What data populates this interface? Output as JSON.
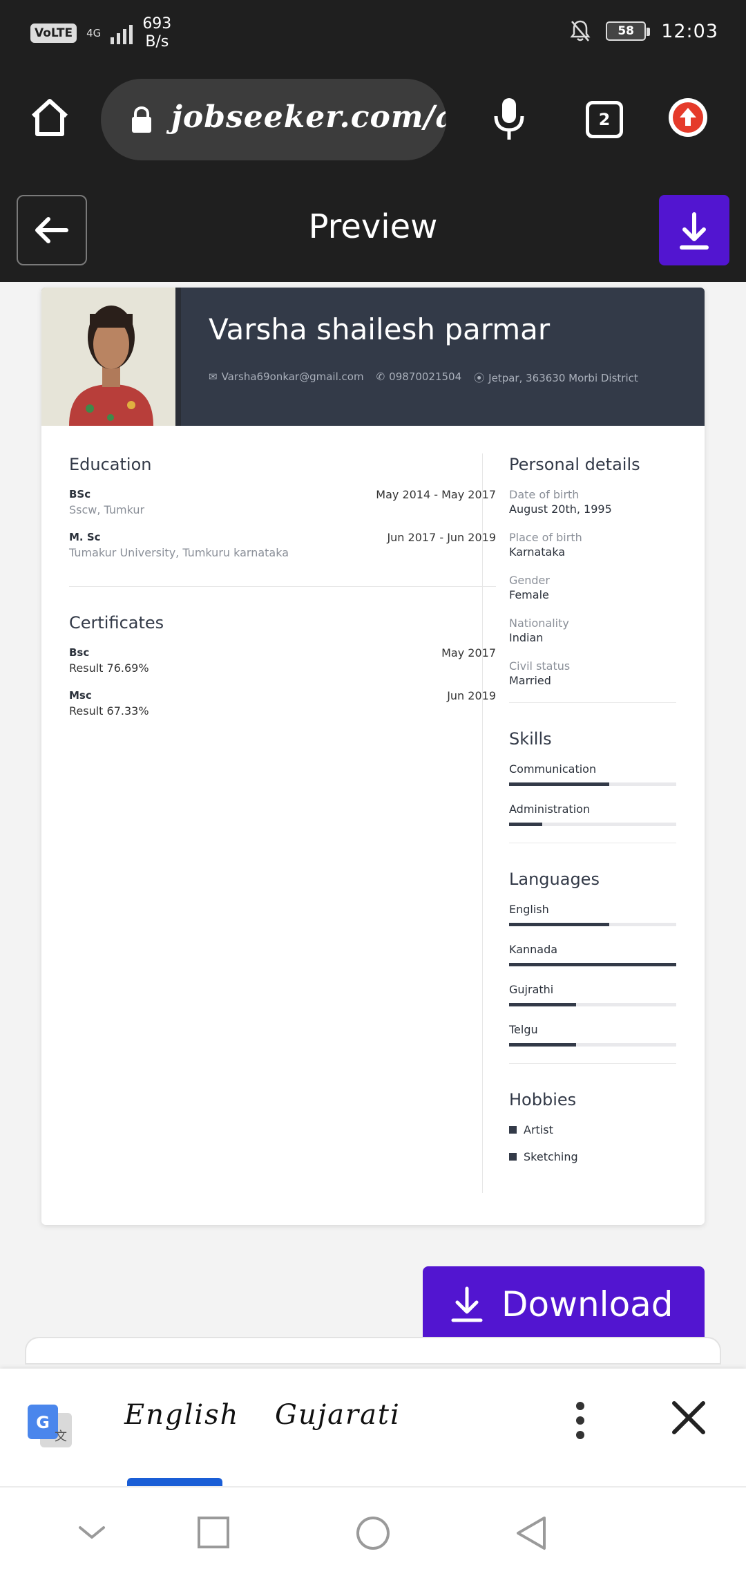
{
  "status_bar": {
    "network_badge": "VoLTE",
    "network_type": "4G",
    "speed_value": "693",
    "speed_unit": "B/s",
    "battery": "58",
    "time": "12:03"
  },
  "browser": {
    "url": "jobseeker.com/a",
    "tab_count": "2"
  },
  "app_header": {
    "title": "Preview"
  },
  "resume": {
    "name": "Varsha shailesh parmar",
    "email": "Varsha69onkar@gmail.com",
    "phone": "09870021504",
    "location": "Jetpar, 363630 Morbi District",
    "education": {
      "title": "Education",
      "items": [
        {
          "degree": "BSc",
          "school": "Sscw, Tumkur",
          "dates": "May 2014 - May 2017"
        },
        {
          "degree": "M. Sc",
          "school": "Tumakur University, Tumkuru karnataka",
          "dates": "Jun 2017 - Jun 2019"
        }
      ]
    },
    "certificates": {
      "title": "Certificates",
      "items": [
        {
          "name": "Bsc",
          "detail": "Result 76.69%",
          "date": "May 2017"
        },
        {
          "name": "Msc",
          "detail": "Result 67.33%",
          "date": "Jun 2019"
        }
      ]
    },
    "personal": {
      "title": "Personal details",
      "items": [
        {
          "label": "Date of birth",
          "value": "August 20th, 1995"
        },
        {
          "label": "Place of birth",
          "value": "Karnataka"
        },
        {
          "label": "Gender",
          "value": "Female"
        },
        {
          "label": "Nationality",
          "value": "Indian"
        },
        {
          "label": "Civil status",
          "value": "Married"
        }
      ]
    },
    "skills": {
      "title": "Skills",
      "items": [
        {
          "name": "Communication",
          "level": 0.6
        },
        {
          "name": "Administration",
          "level": 0.2
        }
      ]
    },
    "languages": {
      "title": "Languages",
      "items": [
        {
          "name": "English",
          "level": 0.6
        },
        {
          "name": "Kannada",
          "level": 1.0
        },
        {
          "name": "Gujrathi",
          "level": 0.4
        },
        {
          "name": "Telgu",
          "level": 0.4
        }
      ]
    },
    "hobbies": {
      "title": "Hobbies",
      "items": [
        "Artist",
        "Sketching"
      ]
    }
  },
  "download_button": {
    "label": "Download"
  },
  "translate_bar": {
    "lang_1": "English",
    "lang_2": "Gujarati"
  },
  "colors": {
    "accent": "#5215d0",
    "resume_header": "#333a48",
    "translate_underline": "#1a5ed6"
  }
}
